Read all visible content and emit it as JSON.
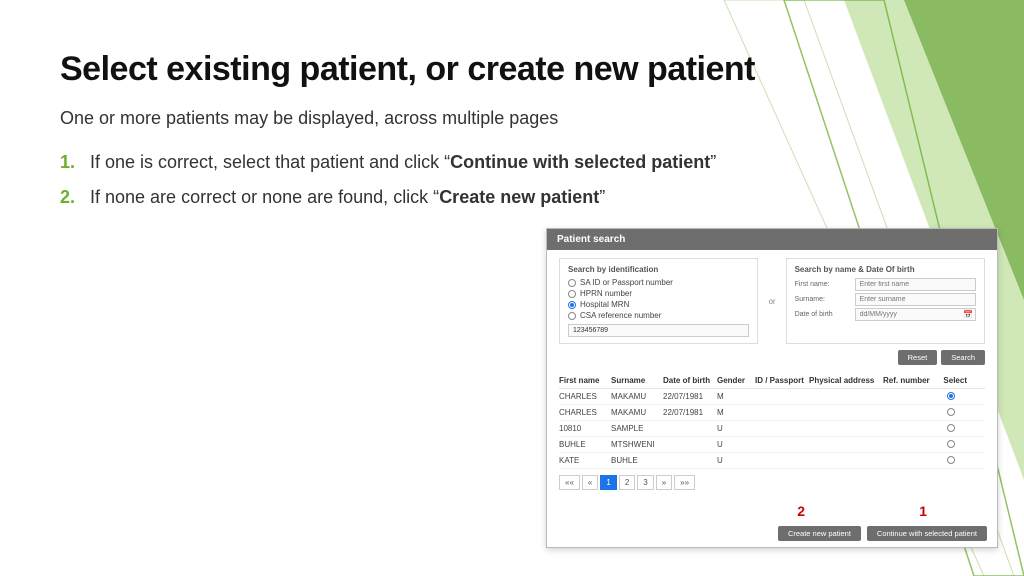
{
  "title": "Select existing patient, or create new patient",
  "subtitle": "One or more patients may be displayed, across multiple pages",
  "bullets": {
    "one_pre": "If one is correct",
    "one_mid": ", select that patient and click “",
    "one_bold": "Continue with selected patient",
    "one_post": "”",
    "two_pre": "If none are correct or none are found, click “",
    "two_bold": "Create new patient",
    "two_post": "”"
  },
  "app": {
    "header": "Patient search",
    "left": {
      "title": "Search by identification",
      "opts": {
        "sa": "SA ID or Passport number",
        "hprn": "HPRN number",
        "mrn": "Hospital MRN",
        "csa": "CSA reference number"
      },
      "value": "123456789"
    },
    "or": "or",
    "right": {
      "title": "Search by name & Date Of birth",
      "first_label": "First name:",
      "first_ph": "Enter first name",
      "surname_label": "Surname:",
      "surname_ph": "Enter surname",
      "dob_label": "Date of birth",
      "dob_ph": "dd/MM/yyyy"
    },
    "reset": "Reset",
    "search": "Search",
    "cols": {
      "first": "First name",
      "surname": "Surname",
      "dob": "Date of birth",
      "gender": "Gender",
      "idp": "ID / Passport",
      "addr": "Physical address",
      "ref": "Ref. number",
      "sel": "Select"
    },
    "rows": [
      {
        "first": "CHARLES",
        "surname": "MAKAMU",
        "dob": "22/07/1981",
        "gender": "M",
        "idp": "",
        "addr": "",
        "ref": "",
        "selected": true
      },
      {
        "first": "CHARLES",
        "surname": "MAKAMU",
        "dob": "22/07/1981",
        "gender": "M",
        "idp": "",
        "addr": "",
        "ref": "",
        "selected": false
      },
      {
        "first": "10810",
        "surname": "SAMPLE",
        "dob": "",
        "gender": "U",
        "idp": "",
        "addr": "",
        "ref": "",
        "selected": false
      },
      {
        "first": "BUHLE",
        "surname": "MTSHWENI",
        "dob": "",
        "gender": "U",
        "idp": "",
        "addr": "",
        "ref": "",
        "selected": false
      },
      {
        "first": "KATE",
        "surname": "BUHLE",
        "dob": "",
        "gender": "U",
        "idp": "",
        "addr": "",
        "ref": "",
        "selected": false
      }
    ],
    "pager": {
      "first": "««",
      "prev": "«",
      "p1": "1",
      "p2": "2",
      "p3": "3",
      "next": "»",
      "last": "»»"
    },
    "create": "Create new patient",
    "continue": "Continue with selected patient"
  },
  "markers": {
    "one": "1",
    "two": "2"
  }
}
